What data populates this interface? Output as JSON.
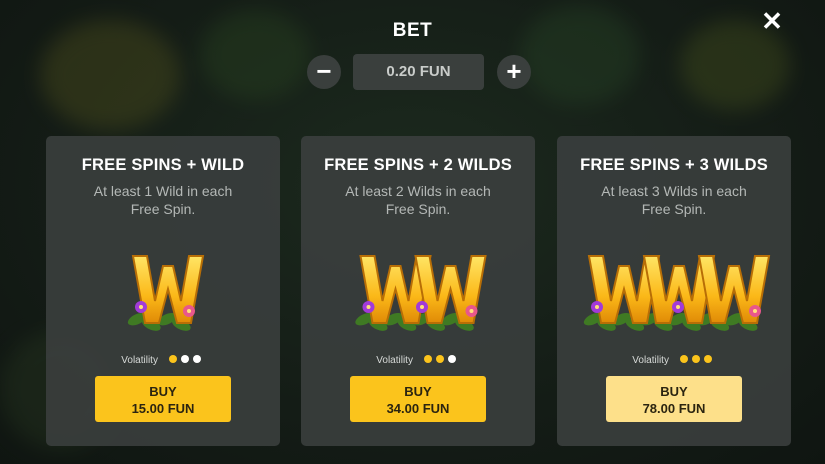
{
  "header": {
    "title": "BET",
    "close_icon": "close-icon"
  },
  "bet": {
    "minus_icon": "minus-icon",
    "plus_icon": "plus-icon",
    "value": "0.20 FUN"
  },
  "colors": {
    "accent": "#fbc41c",
    "accent_light": "#fde08a",
    "card_bg": "#3a3e3d",
    "dot_off": "#ffffff"
  },
  "cards": [
    {
      "title": "FREE SPINS + WILD",
      "desc_line1": "At least 1 Wild in each",
      "desc_line2": "Free Spin.",
      "wild_count": 1,
      "volatility_label": "Volatility",
      "volatility_level": 1,
      "volatility_max": 3,
      "buy_label": "BUY",
      "price": "15.00 FUN"
    },
    {
      "title": "FREE SPINS + 2 WILDS",
      "desc_line1": "At least 2 Wilds in each",
      "desc_line2": "Free Spin.",
      "wild_count": 2,
      "volatility_label": "Volatility",
      "volatility_level": 2,
      "volatility_max": 3,
      "buy_label": "BUY",
      "price": "34.00 FUN"
    },
    {
      "title": "FREE SPINS + 3 WILDS",
      "desc_line1": "At least 3 Wilds in each",
      "desc_line2": "Free Spin.",
      "wild_count": 3,
      "volatility_label": "Volatility",
      "volatility_level": 3,
      "volatility_max": 3,
      "buy_label": "BUY",
      "price": "78.00 FUN"
    }
  ]
}
